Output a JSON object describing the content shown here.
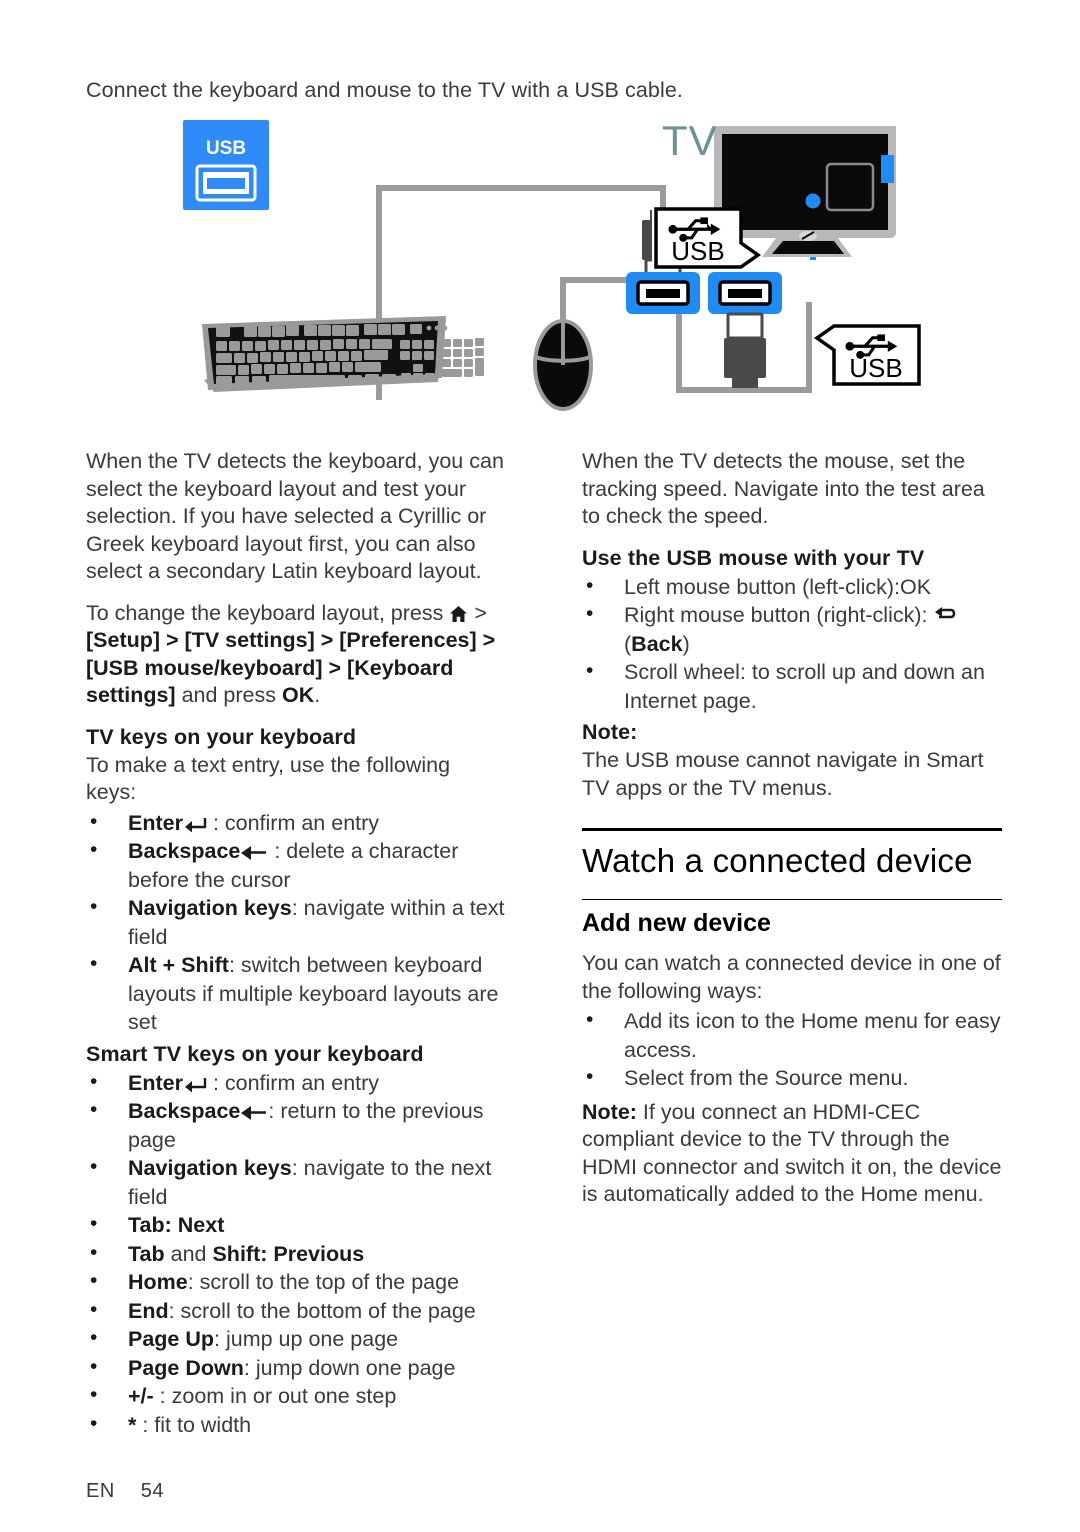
{
  "page": {
    "intro": "Connect the keyboard and mouse to the TV with a USB cable.",
    "footer_lang": "EN",
    "footer_number": "54"
  },
  "figure": {
    "usb_badge_label": "USB",
    "tv_label": "TV",
    "callout_top_label": "USB",
    "callout_bottom_label": "USB",
    "colors": {
      "badge_blue": "#2e8bf7",
      "cable_blue": "#1f8cf5",
      "tv_label_teal": "#6d9199",
      "cable_gray": "#9b9b9b",
      "device_dark": "#3f3f3f",
      "keyboard_gray": "#9a9a9a"
    }
  },
  "left_column": {
    "para_1": "When the TV detects the keyboard, you can select the keyboard layout and test your selection. If you have selected a Cyrillic or Greek keyboard layout first, you can also select a secondary Latin keyboard layout.",
    "para_2_prefix": "To change the keyboard layout, press ",
    "para_2_path": "[Setup] > [TV settings] > [Preferences] > [USB mouse/keyboard] > [Keyboard settings]",
    "para_2_mid": " > ",
    "para_2_suffix": " and press ",
    "para_2_ok": "OK",
    "para_2_end": ".",
    "tv_keys_heading": "TV keys on your keyboard",
    "tv_keys_intro": "To make a text entry, use the following keys:",
    "tv_keys": [
      {
        "key": "Enter",
        "icon": "enter-return-arrow",
        "desc": " : confirm an entry"
      },
      {
        "key": "Backspace",
        "icon": "backspace-left-arrow",
        "desc": " : delete a character before the cursor"
      },
      {
        "key": "Navigation keys",
        "icon": "",
        "desc": ": navigate within a text field"
      },
      {
        "key": "Alt + Shift",
        "icon": "",
        "desc": ": switch between keyboard layouts if multiple keyboard layouts are set"
      }
    ],
    "smart_keys_heading": "Smart TV keys on your keyboard",
    "smart_keys": [
      {
        "key": "Enter",
        "icon": "enter-return-arrow",
        "desc": " : confirm an entry"
      },
      {
        "key": "Backspace",
        "icon": "backspace-left-arrow",
        "desc": ": return to the previous page"
      },
      {
        "key": "Navigation keys",
        "icon": "",
        "desc": ": navigate to the next field"
      },
      {
        "key": "Tab",
        "icon": "",
        "desc": ": Next",
        "desc_bold": true
      },
      {
        "key": "Tab",
        "icon": "",
        "desc": " and ",
        "desc2_key": "Shift",
        "desc3": ": Previous",
        "desc_bold": true
      },
      {
        "key": "Home",
        "icon": "",
        "desc": ": scroll to the top of the page"
      },
      {
        "key": "End",
        "icon": "",
        "desc": ": scroll to the bottom of the page"
      },
      {
        "key": "Page Up",
        "icon": "",
        "desc": ": jump up one page"
      },
      {
        "key": "Page Down",
        "icon": "",
        "desc": ": jump down one page"
      },
      {
        "key": "+/-",
        "icon": "",
        "desc": " : zoom in or out one step"
      },
      {
        "key": "*",
        "icon": "",
        "desc": " : fit to width"
      }
    ]
  },
  "right_column": {
    "para_1": "When the TV detects the mouse, set the tracking speed. Navigate into the test area to check the speed.",
    "mouse_heading": "Use the USB mouse with your TV",
    "mouse_items": [
      {
        "text": "Left mouse button (left-click):",
        "ok": "OK",
        "icon": "",
        "tail": ""
      },
      {
        "text": "Right mouse button (right-click): ",
        "ok": "",
        "icon": "back-arrow",
        "tail": "(Back)",
        "tail_bold_word": "Back"
      },
      {
        "text": "Scroll wheel: to scroll up and down an Internet page.",
        "ok": "",
        "icon": "",
        "tail": ""
      }
    ],
    "note_label": "Note:",
    "note_text": "The USB mouse cannot navigate in Smart TV apps or the TV menus.",
    "section_heading": "Watch a connected device",
    "sub_heading": "Add new device",
    "add_intro": "You can watch a connected device in one of the following ways:",
    "add_items": [
      "Add its icon to the Home menu for easy access.",
      "Select from the Source menu."
    ],
    "note2_label": "Note:",
    "note2_text": " If you connect an HDMI-CEC compliant device to the TV through the HDMI connector and switch it on, the device is automatically added to the Home menu."
  }
}
